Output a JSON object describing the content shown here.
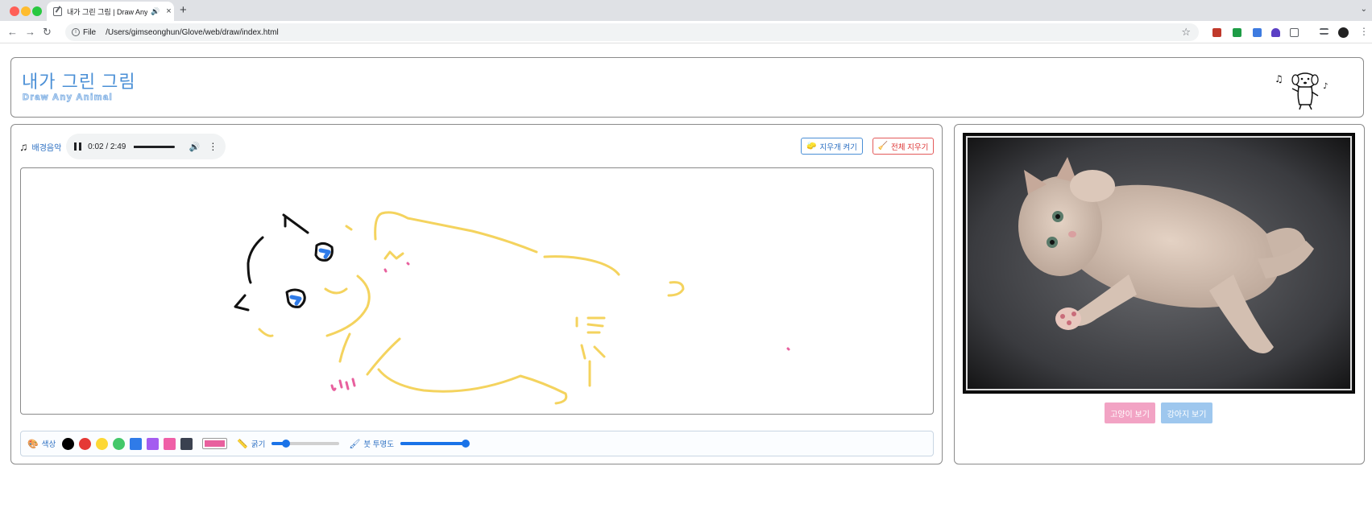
{
  "browser": {
    "tab_title": "내가 그린 그림 | Draw Any A",
    "tab_audio_icon": "speaker-icon",
    "tab_close": "×",
    "new_tab": "+",
    "address_chip": "File",
    "url": "/Users/gimseonghun/Glove/web/draw/index.html"
  },
  "header": {
    "title": "내가 그린 그림",
    "subtitle": "Draw Any Animal",
    "mascot_icon": "dancing-dog-icon"
  },
  "music": {
    "label": "배경음악",
    "icon": "music-note-icon",
    "time": "0:02 / 2:49",
    "progress": 0.012
  },
  "actions": {
    "eraser_label": "지우개 켜기",
    "clear_label": "전체 지우기"
  },
  "toolbar": {
    "color_label": "색상",
    "colors": [
      "#000000",
      "#e53935",
      "#fdd835",
      "#43c86a",
      "#2f7be8",
      "#a45cf0",
      "#ef5fa7",
      "#3a4150"
    ],
    "current_color": "#e8609e",
    "thickness_label": "굵기",
    "thickness_value": 0.2,
    "opacity_label": "붓 투명도",
    "opacity_value": 1.0
  },
  "preview": {
    "image_subject": "kitten lying on gray carpet",
    "cat_button": "고양이 보기",
    "dog_button": "강아지 보기"
  },
  "accent_colors": {
    "title_blue": "#4a8fd6",
    "cat_pink": "#f2a3c4",
    "dog_blue": "#9ec7ee"
  }
}
